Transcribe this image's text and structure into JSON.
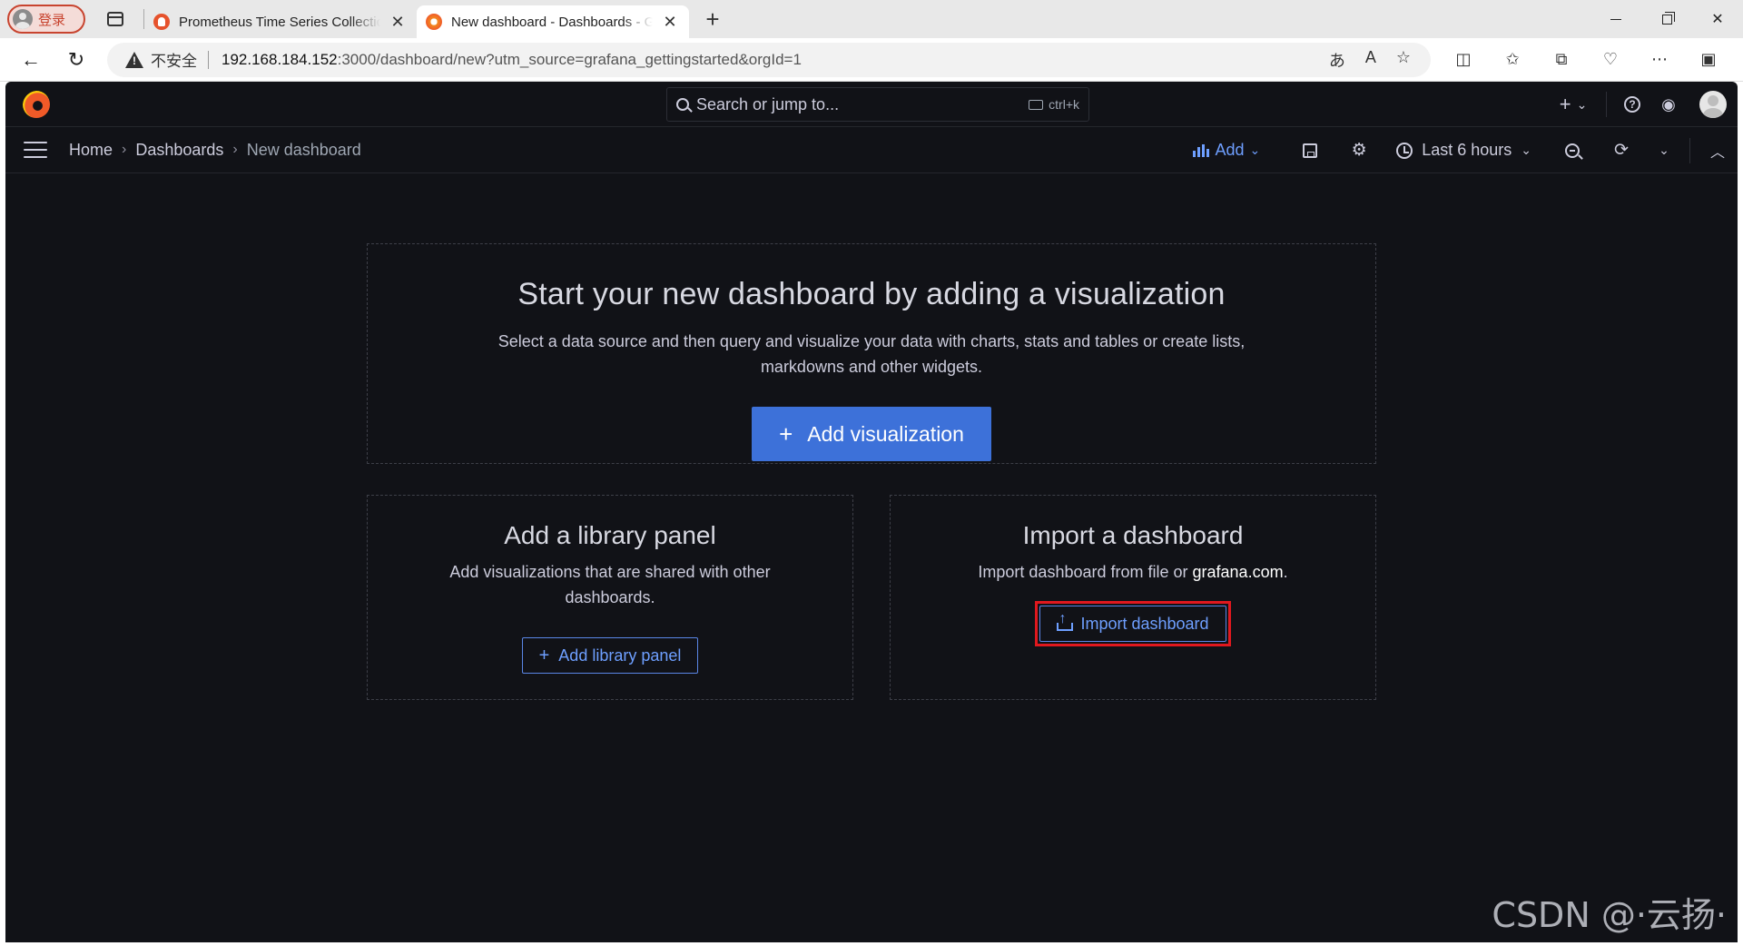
{
  "browser": {
    "profile_label": "登录",
    "tabs": [
      {
        "title": "Prometheus Time Series Collection",
        "active": false
      },
      {
        "title": "New dashboard - Dashboards - Grafana",
        "active": true
      }
    ],
    "new_tab": "+",
    "close_glyph": "✕",
    "insecure_label": "不安全",
    "url_host": "192.168.184.152",
    "url_rest": ":3000/dashboard/new?utm_source=grafana_gettingstarted&orgId=1"
  },
  "grafana": {
    "search_placeholder": "Search or jump to...",
    "search_shortcut": "ctrl+k",
    "breadcrumb": {
      "home": "Home",
      "dashboards": "Dashboards",
      "current": "New dashboard",
      "separator": "›"
    },
    "toolbar": {
      "add_label": "Add",
      "time_range": "Last 6 hours"
    },
    "empty_state": {
      "title": "Start your new dashboard by adding a visualization",
      "description": "Select a data source and then query and visualize your data with charts, stats and tables or create lists, markdowns and other widgets.",
      "add_visualization": "Add visualization"
    },
    "library_panel": {
      "title": "Add a library panel",
      "description": "Add visualizations that are shared with other dashboards.",
      "button": "Add library panel"
    },
    "import": {
      "title": "Import a dashboard",
      "description_prefix": "Import dashboard from file or ",
      "link": "grafana.com",
      "description_suffix": ".",
      "button": "Import dashboard"
    }
  },
  "watermark": "CSDN @·云扬·",
  "colors": {
    "grafana_bg": "#111217",
    "primary": "#3d71d9",
    "link_blue": "#6e9fff",
    "highlight_red": "#e0181e"
  }
}
